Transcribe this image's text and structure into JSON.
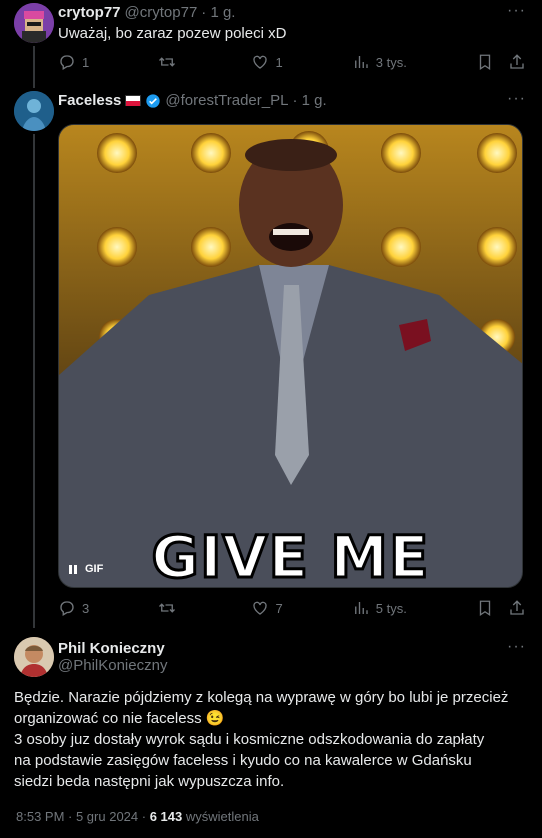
{
  "reply1": {
    "name": "crytop77",
    "handle": "@crytop77",
    "time": "· 1 g.",
    "text": "Uważaj, bo zaraz pozew poleci xD",
    "replies": "1",
    "retweets": "",
    "likes": "1",
    "views": "3 tys."
  },
  "reply2": {
    "name": "Faceless",
    "handle": "@forestTrader_PL",
    "time": "· 1 g.",
    "gif_caption": "GIVE ME",
    "gif_label": "GIF",
    "replies": "3",
    "retweets": "",
    "likes": "7",
    "views": "5 tys."
  },
  "main": {
    "name": "Phil Konieczny",
    "handle": "@PhilKonieczny",
    "line1": "Będzie. Narazie pójdziemy z kolegą na wyprawę w góry bo lubi je przecież",
    "line2": "organizować co nie faceless 😉",
    "line3": "3 osoby juz dostały wyrok sądu i kosmiczne odszkodowania do zapłaty",
    "line4": "na podstawie zasięgów faceless i kyudo co na kawalerce w Gdańsku",
    "line5": "siedzi beda następni jak wypuszcza info.",
    "timestamp": "8:53 PM · 5 gru 2024 ·",
    "view_count": "6 143",
    "view_label": "wyświetlenia"
  },
  "colors": {
    "background": "#000000",
    "text": "#e7e9ea",
    "muted": "#71767b",
    "verified": "#1d9bf0",
    "divider": "#2f3336"
  }
}
